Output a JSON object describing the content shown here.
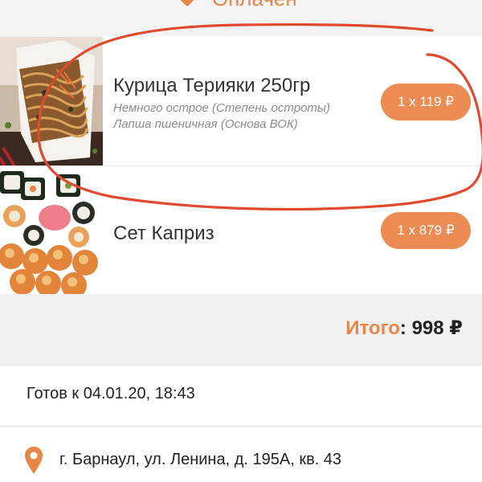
{
  "status": {
    "icon": "map-pin-icon",
    "label": "Оплачен"
  },
  "items": [
    {
      "name": "Курица Терияки 250гр",
      "options": [
        "Немного острое (Степень остроты)",
        "Лапша пшеничная (Основа ВОК)"
      ],
      "quantity_price": "1 x 119 ₽",
      "image": "wok-noodles-photo"
    },
    {
      "name": "Сет Каприз",
      "options": [],
      "quantity_price": "1 x 879 ₽",
      "image": "sushi-set-photo"
    }
  ],
  "total": {
    "label": "Итого",
    "colon": ":",
    "value": "998 ₽"
  },
  "ready": "Готов к 04.01.20, 18:43",
  "address": {
    "icon": "map-pin-icon",
    "text": "г. Барнаул, ул. Ленина, д. 195А, кв. 43"
  },
  "colors": {
    "accent": "#ec8c54",
    "annotation": "#e04a2e"
  }
}
